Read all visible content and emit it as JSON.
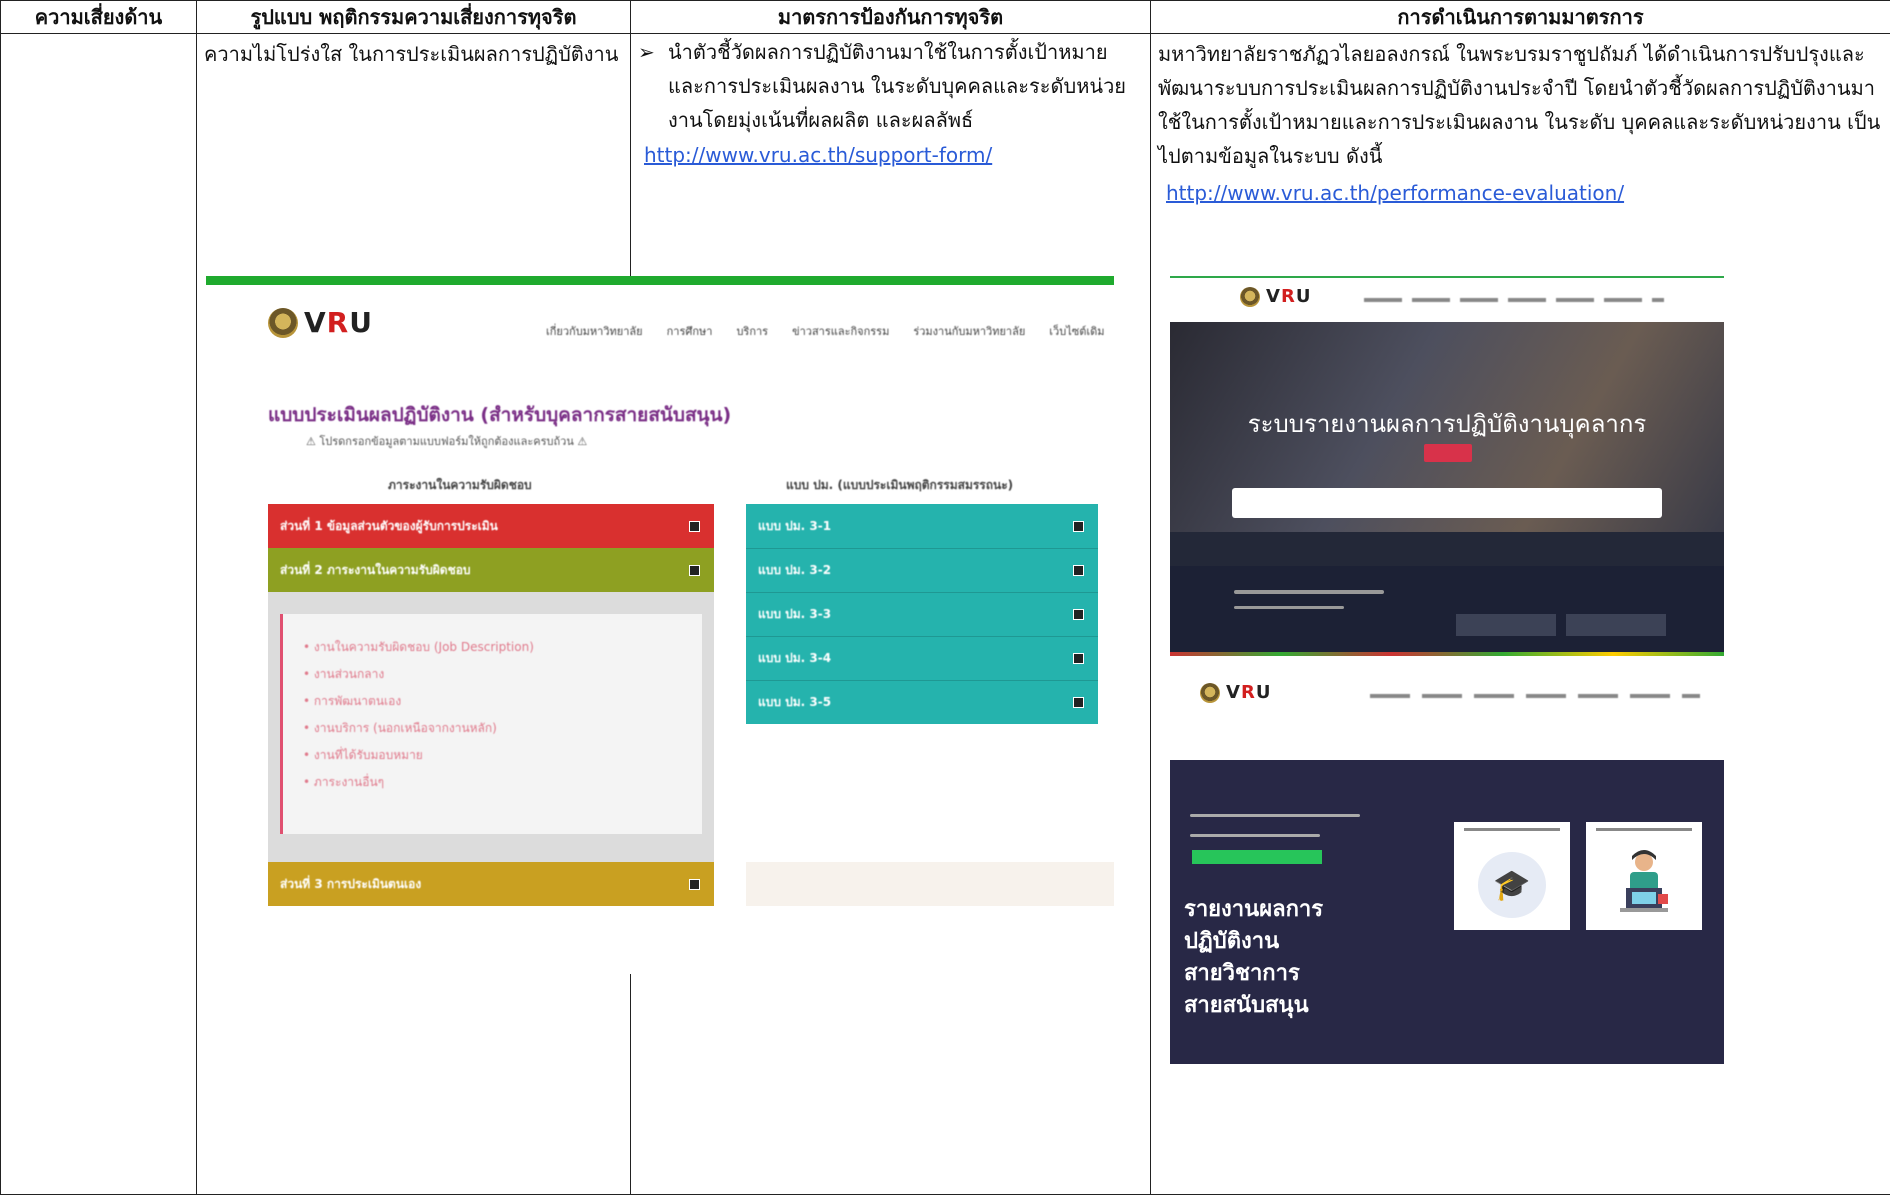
{
  "headers": {
    "col1": "ความเสี่ยงด้าน",
    "col2": "รูปแบบ พฤติกรรมความเสี่ยงการทุจริต",
    "col3": "มาตรการป้องกันการทุจริต",
    "col4": "การดำเนินการตามมาตรการ"
  },
  "row": {
    "risk_area": "",
    "behavior": "ความไม่โปร่งใส ในการประเมินผลการปฏิบัติงาน",
    "measure": "นำตัวชี้วัดผลการปฏิบัติงานมาใช้ในการตั้งเป้าหมายและการประเมินผลงาน ในระดับบุคคลและระดับหน่วยงานโดยมุ่งเน้นที่ผลผลิต และผลลัพธ์",
    "measure_link": "http://www.vru.ac.th/support-form/",
    "action": "มหาวิทยาลัยราชภัฏวไลยอลงกรณ์ ในพระบรมราชูปถัมภ์ ได้ดำเนินการปรับปรุงและพัฒนาระบบการประเมินผลการปฏิบัติงานประจำปี โดยนำตัวชี้วัดผลการปฏิบัติงานมาใช้ในการตั้งเป้าหมายและการประเมินผลงาน ในระดับ  บุคคลและระดับหน่วยงาน เป็นไปตามข้อมูลในระบบ ดังนี้",
    "action_link": "http://www.vru.ac.th/performance-evaluation/"
  },
  "shot1": {
    "logo_prefix": "V",
    "logo_accent": "R",
    "logo_suffix": "U",
    "nav": [
      "เกี่ยวกับมหาวิทยาลัย",
      "การศึกษา",
      "บริการ",
      "ข่าวสารและกิจกรรม",
      "ร่วมงานกับมหาวิทยาลัย",
      "เว็บไซต์เดิม"
    ],
    "title": "แบบประเมินผลปฏิบัติงาน (สำหรับบุคลากรสายสนับสนุน)",
    "warning": "⚠ โปรดกรอกข้อมูลตามแบบฟอร์มให้ถูกต้องและครบถ้วน ⚠",
    "left_heading": "ภาระงานในความรับผิดชอบ",
    "right_heading": "แบบ ปม. (แบบประเมินพฤติกรรมสมรรถนะ)",
    "section1": "ส่วนที่ 1 ข้อมูลส่วนตัวของผู้รับการประเมิน",
    "section2": "ส่วนที่ 2 ภาระงานในความรับผิดชอบ",
    "section3": "ส่วนที่ 3 การประเมินตนเอง",
    "section2_items": [
      "งานในความรับผิดชอบ (Job Description)",
      "งานส่วนกลาง",
      "การพัฒนาตนเอง",
      "งานบริการ (นอกเหนือจากงานหลัก)",
      "งานที่ได้รับมอบหมาย",
      "ภาระงานอื่นๆ"
    ],
    "forms": [
      "แบบ ปม. 3-1",
      "แบบ ปม. 3-2",
      "แบบ ปม. 3-3",
      "แบบ ปม. 3-4",
      "แบบ ปม. 3-5"
    ],
    "colors": {
      "red": "#d9302f",
      "olive": "#8ea022",
      "gold": "#c9a021",
      "teal": "#25b3ad",
      "top_bar": "#1faa2e"
    }
  },
  "shot2": {
    "hero_title": "ระบบรายงานผลการปฏิบัติงานบุคลากร",
    "report_lines": [
      "รายงานผลการ",
      "ปฏิบัติงาน",
      "สายวิชาการ",
      "สายสนับสนุน"
    ]
  }
}
